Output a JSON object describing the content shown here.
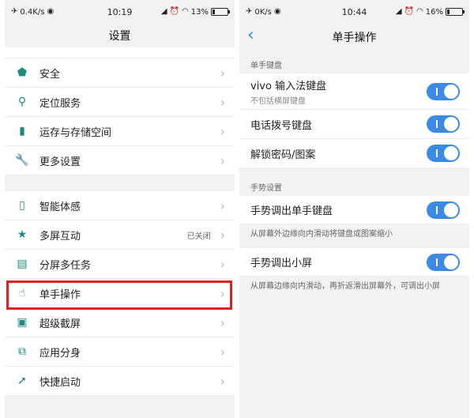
{
  "left": {
    "status": {
      "speed": "0.4K/s",
      "time": "10:19",
      "battery": "13%"
    },
    "title": "设置",
    "top_partial": "",
    "group1": [
      {
        "label": "安全",
        "icon": "shield-icon"
      },
      {
        "label": "定位服务",
        "icon": "location-pin-icon"
      },
      {
        "label": "运存与存储空间",
        "icon": "sd-card-icon"
      },
      {
        "label": "更多设置",
        "icon": "wrench-icon"
      }
    ],
    "group2": [
      {
        "label": "智能体感",
        "icon": "phone-shake-icon",
        "value": ""
      },
      {
        "label": "多屏互动",
        "icon": "star-screen-icon",
        "value": "已关闭"
      },
      {
        "label": "分屏多任务",
        "icon": "split-screen-icon",
        "value": ""
      },
      {
        "label": "单手操作",
        "icon": "hand-tap-icon",
        "value": ""
      },
      {
        "label": "超级截屏",
        "icon": "screenshot-icon",
        "value": ""
      },
      {
        "label": "应用分身",
        "icon": "clone-app-icon",
        "value": ""
      },
      {
        "label": "快捷启动",
        "icon": "quick-launch-icon",
        "value": ""
      }
    ]
  },
  "right": {
    "status": {
      "speed": "0K/s",
      "time": "10:44",
      "battery": "16%"
    },
    "title": "单手操作",
    "section1": "单手键盘",
    "keyboard_items": [
      {
        "label": "vivo 输入法键盘",
        "sub": "不包括横屏键盘",
        "on": true
      },
      {
        "label": "电话拨号键盘",
        "sub": "",
        "on": true
      },
      {
        "label": "解锁密码/图案",
        "sub": "",
        "on": true
      }
    ],
    "section2": "手势设置",
    "gesture1": {
      "label": "手势调出单手键盘",
      "desc": "从屏幕外边缘向内滑动将键盘或图案缩小",
      "on": true
    },
    "gesture2": {
      "label": "手势调出小屏",
      "desc": "从屏幕边缘向内滑动，再折返滑出屏幕外，可调出小屏",
      "on": true
    }
  },
  "colors": {
    "accent": "#3b8ae6",
    "highlight": "#e02020",
    "icon": "#1b8b80"
  },
  "battery_levels": {
    "left": 0.13,
    "right": 0.16
  }
}
